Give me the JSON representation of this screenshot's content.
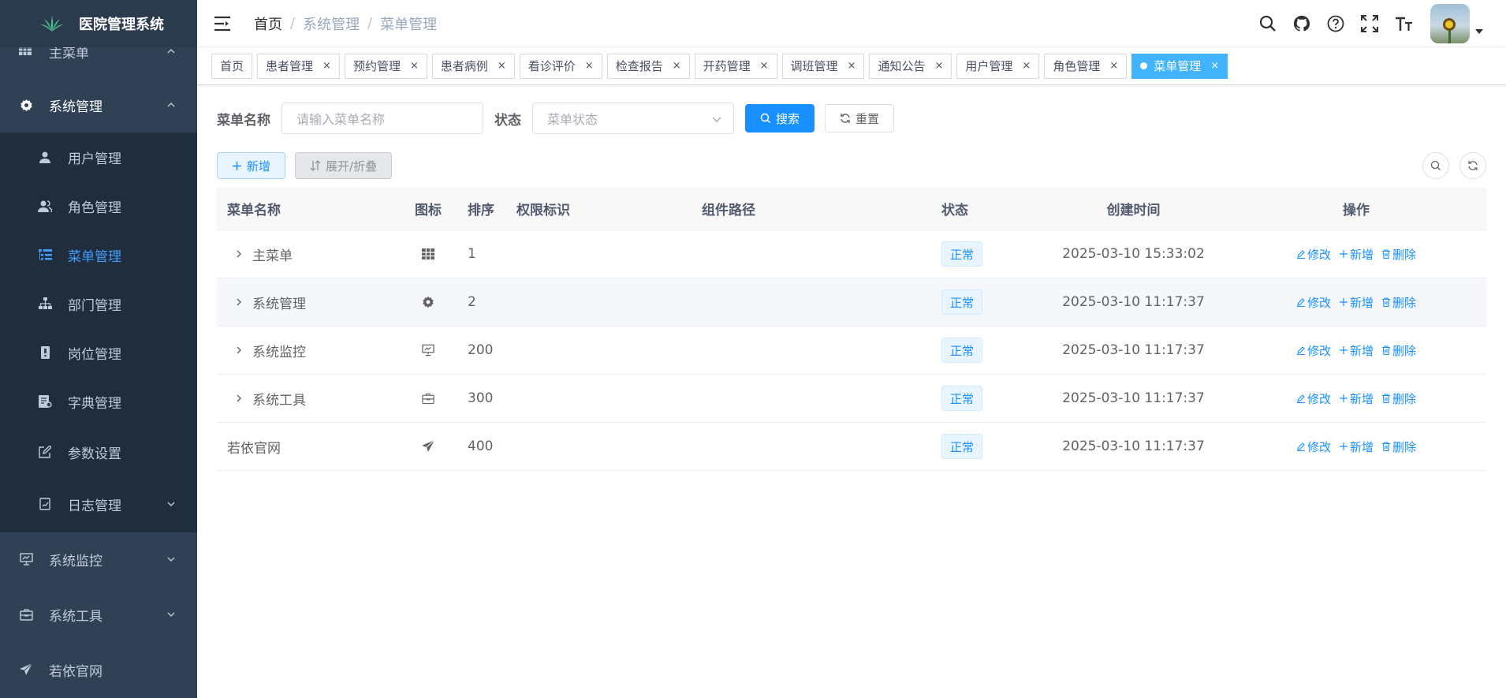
{
  "app": {
    "title": "医院管理系统"
  },
  "sidebar": {
    "partial_item": "主菜单",
    "items": [
      {
        "label": "系统管理",
        "icon": "gear-icon"
      },
      {
        "label": "用户管理",
        "icon": "user-icon"
      },
      {
        "label": "角色管理",
        "icon": "peoples-icon"
      },
      {
        "label": "菜单管理",
        "icon": "tree-table-icon"
      },
      {
        "label": "部门管理",
        "icon": "tree-icon"
      },
      {
        "label": "岗位管理",
        "icon": "post-icon"
      },
      {
        "label": "字典管理",
        "icon": "dict-icon"
      },
      {
        "label": "参数设置",
        "icon": "edit-icon"
      },
      {
        "label": "日志管理",
        "icon": "log-icon"
      },
      {
        "label": "系统监控",
        "icon": "monitor-icon"
      },
      {
        "label": "系统工具",
        "icon": "tool-icon"
      },
      {
        "label": "若依官网",
        "icon": "guide-icon"
      }
    ]
  },
  "header": {
    "breadcrumb": [
      "首页",
      "系统管理",
      "菜单管理"
    ],
    "breadcrumb_sep": "/"
  },
  "tags": [
    {
      "label": "首页",
      "closable": false
    },
    {
      "label": "患者管理",
      "closable": true
    },
    {
      "label": "预约管理",
      "closable": true
    },
    {
      "label": "患者病例",
      "closable": true
    },
    {
      "label": "看诊评价",
      "closable": true
    },
    {
      "label": "检查报告",
      "closable": true
    },
    {
      "label": "开药管理",
      "closable": true
    },
    {
      "label": "调班管理",
      "closable": true
    },
    {
      "label": "通知公告",
      "closable": true
    },
    {
      "label": "用户管理",
      "closable": true
    },
    {
      "label": "角色管理",
      "closable": true
    },
    {
      "label": "菜单管理",
      "closable": true,
      "active": true
    }
  ],
  "tag_close": "×",
  "search": {
    "name_label": "菜单名称",
    "name_placeholder": "请输入菜单名称",
    "status_label": "状态",
    "status_placeholder": "菜单状态",
    "search_btn": "搜索",
    "reset_btn": "重置"
  },
  "toolbar": {
    "add_btn": "新增",
    "expand_btn": "展开/折叠"
  },
  "table": {
    "headers": [
      "菜单名称",
      "图标",
      "排序",
      "权限标识",
      "组件路径",
      "状态",
      "创建时间",
      "操作"
    ],
    "rows": [
      {
        "name": "主菜单",
        "icon": "table-icon",
        "sort": "1",
        "perms": "",
        "component": "",
        "status": "正常",
        "created": "2025-03-10 15:33:02",
        "expandable": true
      },
      {
        "name": "系统管理",
        "icon": "gear-icon",
        "sort": "2",
        "perms": "",
        "component": "",
        "status": "正常",
        "created": "2025-03-10 11:17:37",
        "expandable": true
      },
      {
        "name": "系统监控",
        "icon": "monitor-icon",
        "sort": "200",
        "perms": "",
        "component": "",
        "status": "正常",
        "created": "2025-03-10 11:17:37",
        "expandable": true
      },
      {
        "name": "系统工具",
        "icon": "tool-icon",
        "sort": "300",
        "perms": "",
        "component": "",
        "status": "正常",
        "created": "2025-03-10 11:17:37",
        "expandable": true
      },
      {
        "name": "若依官网",
        "icon": "guide-icon",
        "sort": "400",
        "perms": "",
        "component": "",
        "status": "正常",
        "created": "2025-03-10 11:17:37",
        "expandable": false
      }
    ],
    "ops": {
      "edit": "修改",
      "add": "新增",
      "delete": "删除"
    }
  },
  "colors": {
    "sidebar_bg": "#304156",
    "submenu_bg": "#1f2d3d",
    "primary": "#1890ff",
    "active_tag": "#42b4ff"
  }
}
